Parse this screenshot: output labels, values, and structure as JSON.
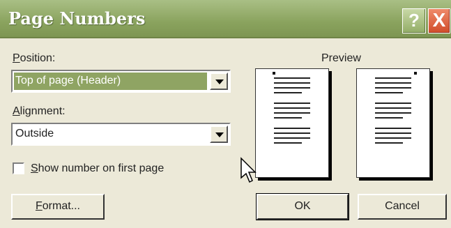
{
  "title": "Page Numbers",
  "title_buttons": {
    "help": "?",
    "close": "X"
  },
  "position": {
    "label_prefix": "P",
    "label_rest": "osition:",
    "selected": "Top of page (Header)"
  },
  "alignment": {
    "label_prefix": "A",
    "label_rest": "lignment:",
    "selected": "Outside"
  },
  "show_first": {
    "label_prefix": "S",
    "label_rest": "how number on first page",
    "checked": false
  },
  "preview": {
    "label": "Preview"
  },
  "buttons": {
    "format_prefix": "F",
    "format_rest": "ormat...",
    "ok": "OK",
    "cancel": "Cancel"
  },
  "colors": {
    "titlebar": "#8aa35e",
    "selection": "#8fa463",
    "close": "#d14d2b"
  }
}
